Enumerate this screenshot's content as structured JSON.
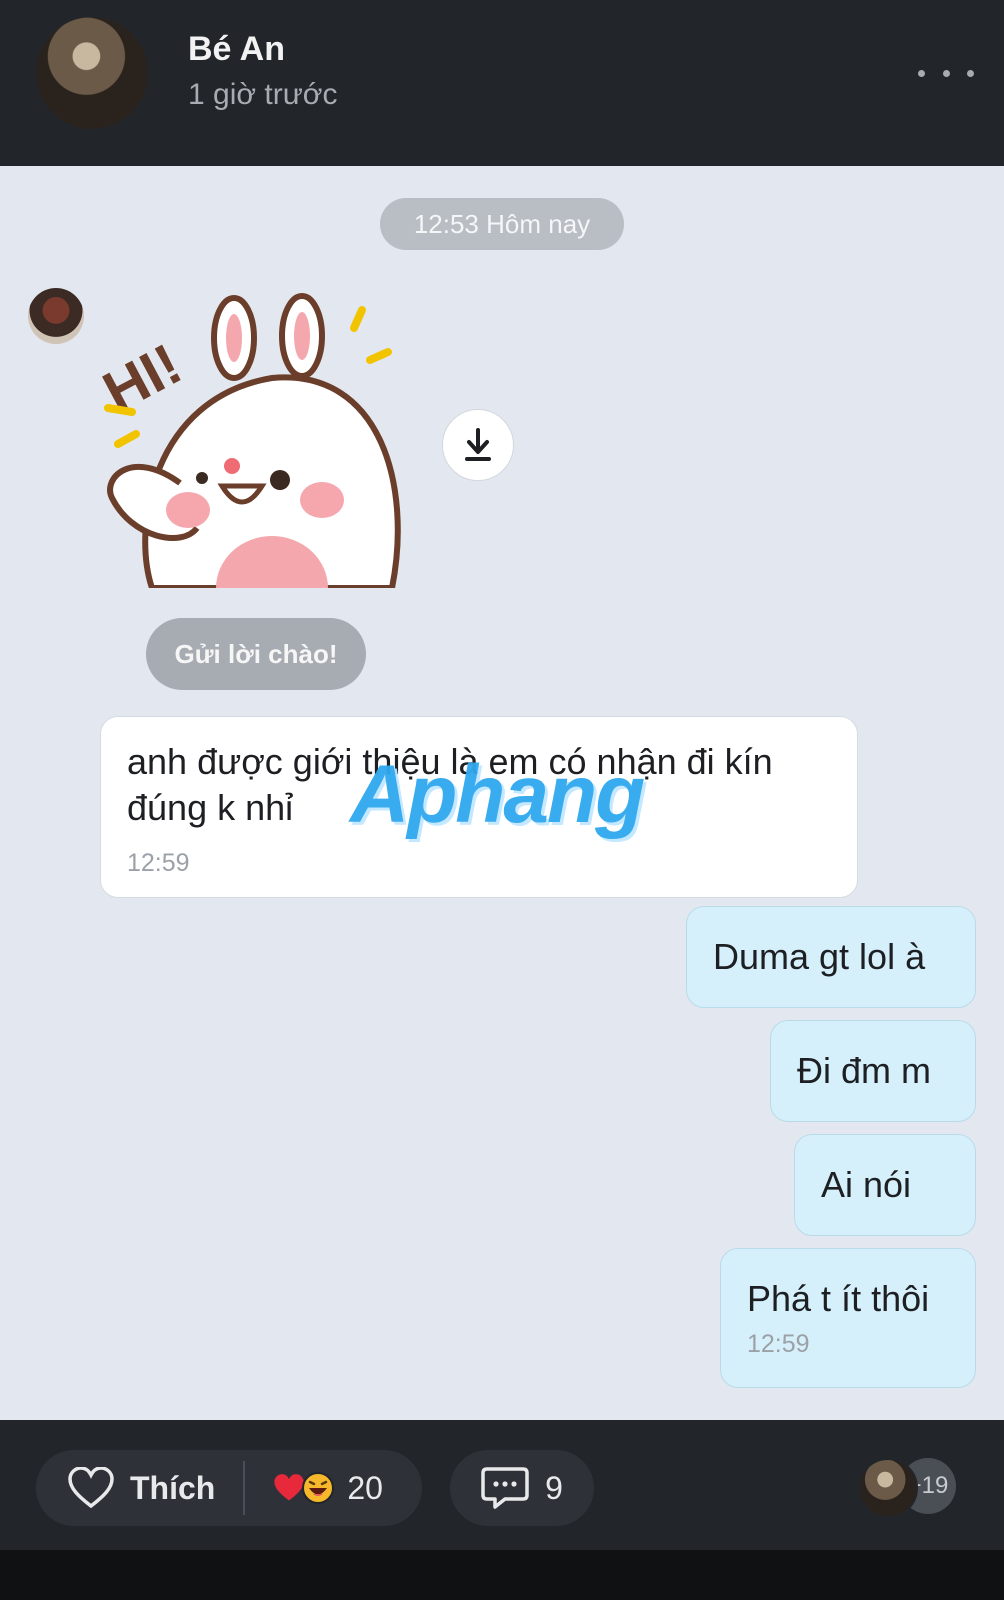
{
  "post": {
    "author_name": "Bé An",
    "posted_time": "1 giờ trước"
  },
  "chat": {
    "day_stamp": "12:53 Hôm nay",
    "greet_button": "Gửi lời chào!",
    "incoming": {
      "text": "anh được giới thiệu là em có nhận đi kín đúng k nhỉ",
      "time": "12:59"
    },
    "outgoing": [
      {
        "text": "Duma gt lol à"
      },
      {
        "text": "Đi đm m"
      },
      {
        "text": "Ai nói"
      },
      {
        "text": "Phá t ít thôi",
        "time": "12:59"
      }
    ],
    "sticker_text": "HI!",
    "watermark": "Aphang"
  },
  "footer": {
    "like_label": "Thích",
    "reaction_count": "20",
    "comment_count": "9",
    "viewers_more": "+19"
  },
  "colors": {
    "header_bg": "#22252a",
    "chat_bg": "#e3e8f0",
    "outgoing_bubble": "#d5f0fa",
    "incoming_bubble": "#ffffff"
  },
  "icons": [
    "more-icon",
    "download-icon",
    "heart-outline-icon",
    "heart-reaction-icon",
    "haha-reaction-icon",
    "comment-icon"
  ]
}
